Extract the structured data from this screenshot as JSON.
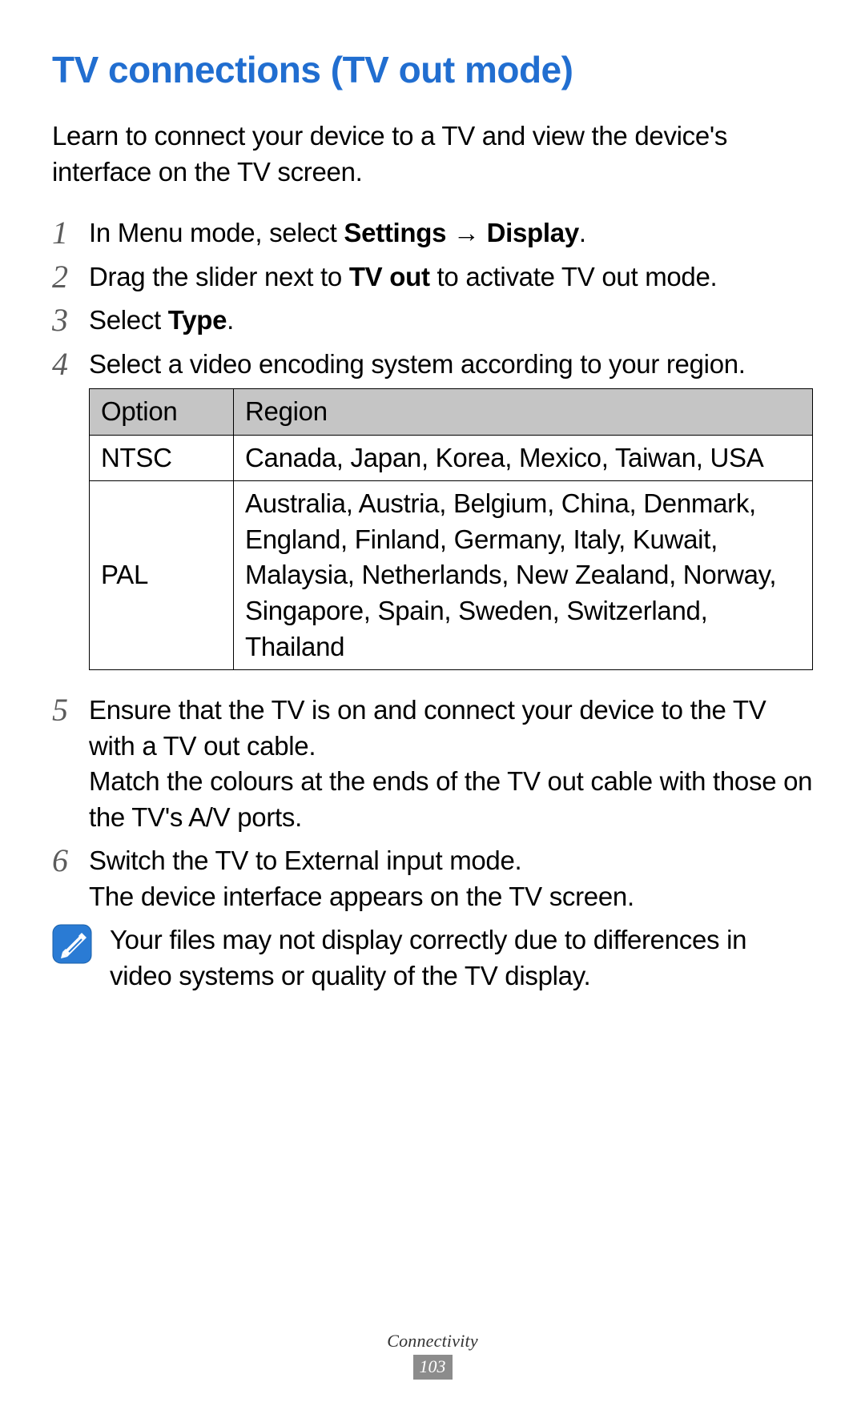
{
  "title": "TV connections (TV out mode)",
  "intro": "Learn to connect your device to a TV and view the device's interface on the TV screen.",
  "steps": {
    "s1": {
      "num": "1",
      "pre": "In Menu mode, select ",
      "b1": "Settings",
      "arrow": " → ",
      "b2": "Display",
      "post": "."
    },
    "s2": {
      "num": "2",
      "pre": "Drag the slider next to ",
      "b1": "TV out",
      "post": " to activate TV out mode."
    },
    "s3": {
      "num": "3",
      "pre": "Select ",
      "b1": "Type",
      "post": "."
    },
    "s4": {
      "num": "4",
      "text": "Select a video encoding system according to your region."
    },
    "s5": {
      "num": "5",
      "p1": "Ensure that the TV is on and connect your device to the TV with a TV out cable.",
      "p2": "Match the colours at the ends of the TV out cable with those on the TV's A/V ports."
    },
    "s6": {
      "num": "6",
      "p1": "Switch the TV to External input mode.",
      "p2": "The device interface appears on the TV screen."
    }
  },
  "table": {
    "h1": "Option",
    "h2": "Region",
    "r1c1": "NTSC",
    "r1c2": "Canada, Japan, Korea, Mexico, Taiwan, USA",
    "r2c1": "PAL",
    "r2c2": "Australia, Austria, Belgium, China, Denmark, England, Finland, Germany, Italy, Kuwait, Malaysia, Netherlands, New Zealand, Norway, Singapore, Spain, Sweden, Switzerland, Thailand"
  },
  "note": "Your files may not display correctly due to differences in video systems or quality of the TV display.",
  "footer": {
    "section": "Connectivity",
    "page": "103"
  }
}
